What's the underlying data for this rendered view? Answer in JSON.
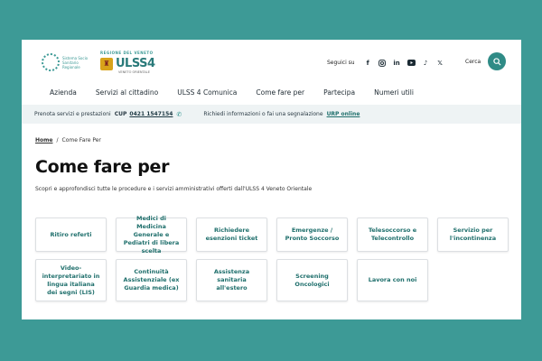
{
  "header": {
    "ssr_logo_text": "Sistema Socio Sanitario Regionale",
    "ulss_top": "REGIONE DEL VENETO",
    "ulss_name": "ULSS4",
    "ulss_sub": "VENETO ORIENTALE",
    "social_label": "Seguici su",
    "social_icons": [
      "facebook-icon",
      "instagram-icon",
      "linkedin-icon",
      "youtube-icon",
      "tiktok-icon",
      "x-icon"
    ],
    "search_label": "Cerca"
  },
  "nav": [
    "Azienda",
    "Servizi al cittadino",
    "ULSS 4 Comunica",
    "Come fare per",
    "Partecipa",
    "Numeri utili"
  ],
  "infobar": {
    "prenota_text": "Prenota servizi e prestazioni",
    "cup_label": "CUP",
    "cup_number": "0421 1547154",
    "urp_text": "Richiedi informazioni o fai una segnalazione",
    "urp_link": "URP online"
  },
  "breadcrumb": {
    "home": "Home",
    "separator": "/",
    "current": "Come Fare Per"
  },
  "main": {
    "title": "Come fare per",
    "subtitle": "Scopri e approfondisci tutte le procedure e i servizi amministrativi offerti dall'ULSS 4 Veneto Orientale"
  },
  "cards": [
    "Ritiro referti",
    "Medici di Medicina Generale e Pediatri di libera scelta",
    "Richiedere esenzioni ticket",
    "Emergenze / Pronto Soccorso",
    "Telesoccorso e Telecontrollo",
    "Servizio per l'incontinenza",
    "Video-interpretariato in lingua italiana dei segni (LIS)",
    "Continuità Assistenziale (ex Guardia medica)",
    "Assistenza sanitaria all'estero",
    "Screening Oncologici",
    "Lavora con noi"
  ],
  "colors": {
    "background": "#3d9a96",
    "accent": "#2f8b86",
    "link": "#1f6f6c",
    "infobar": "#eef3f4"
  }
}
